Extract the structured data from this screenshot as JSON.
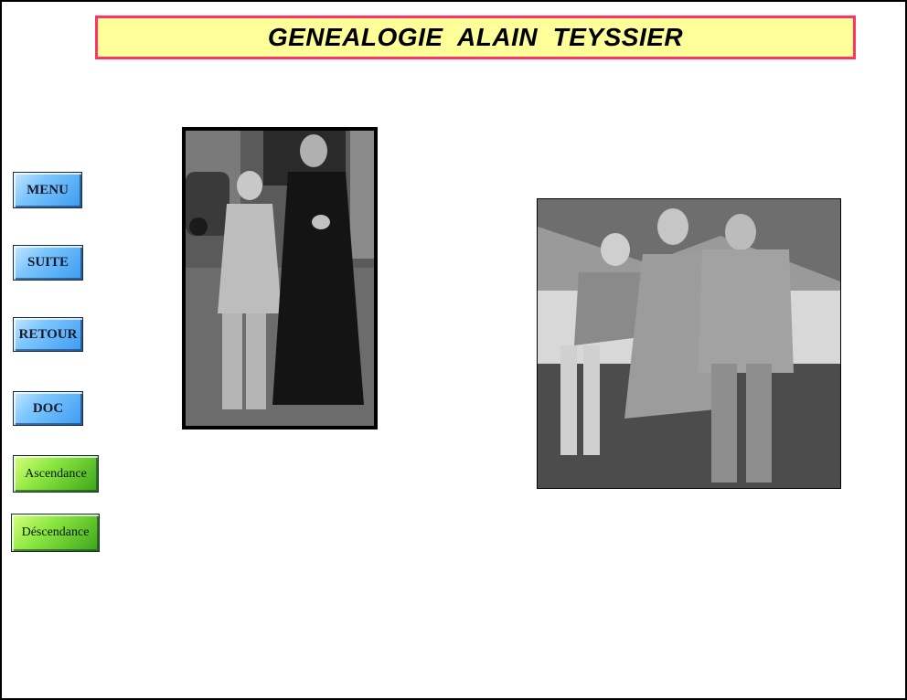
{
  "header": {
    "title": "GENEALOGIE  ALAIN  TEYSSIER"
  },
  "nav": {
    "menu_label": "MENU",
    "suite_label": "SUITE",
    "retour_label": "RETOUR",
    "doc_label": "DOC",
    "ascendance_label": "Ascendance",
    "descendance_label": "Déscendance"
  },
  "colors": {
    "title_background": "#ffff99",
    "title_border": "#ff3366",
    "nav_primary": "#5fb2f8",
    "nav_secondary": "#6fd232"
  },
  "photos": [
    {
      "kind": "black-and-white photograph",
      "subject": "boy in light suit beside priest in cassock"
    },
    {
      "kind": "black-and-white photograph",
      "subject": "boy, woman and man seated on a stone wall"
    }
  ]
}
